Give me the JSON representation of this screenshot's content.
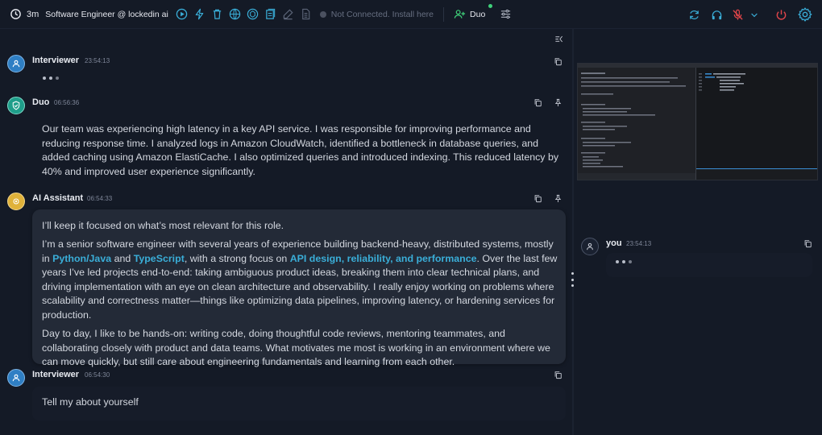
{
  "topbar": {
    "elapsed": "3m",
    "session_title": "Software Engineer @ lockedin ai",
    "connection_status": "Not Connected. Install here",
    "duo_label": "Duo"
  },
  "messages": [
    {
      "speaker": "Interviewer",
      "time": "23:54:13",
      "typing": true
    },
    {
      "speaker": "Duo",
      "time": "06:56:36",
      "text": "Our team was experiencing high latency in a key API service. I was responsible for improving performance and reducing response time. I analyzed logs in Amazon CloudWatch, identified a bottleneck in database queries, and added caching using Amazon ElastiCache. I also optimized queries and introduced indexing. This reduced latency by 40% and improved user experience significantly."
    },
    {
      "speaker": "AI Assistant",
      "time": "06:54:33",
      "intro": "I’ll keep it focused on what’s most relevant for this role.",
      "p2_a": "I’m a senior software engineer with several years of experience building backend-heavy, distributed systems, mostly in",
      "p2_hl1": "Python/Java",
      "p2_and": "and",
      "p2_hl2": "TypeScript",
      "p2_b": ", with a strong focus on",
      "p2_hl3": "API design, reliability, and performance",
      "p2_c": ". Over the last few years I’ve led projects end-to-end: taking ambiguous product ideas, breaking them into clear technical plans, and driving implementation with an eye on clean architecture and observability. I really enjoy working on problems where scalability and correctness matter—things like optimizing data pipelines, improving latency, or hardening services for production.",
      "p3": "Day to day, I like to be hands-on: writing code, doing thoughtful code reviews, mentoring teammates, and collaborating closely with product and data teams. What motivates me most is working in an environment where we can move quickly, but still care about engineering fundamentals and learning from each other."
    },
    {
      "speaker": "Interviewer",
      "time": "06:54:30",
      "text": "Tell my about yourself"
    }
  ],
  "side": {
    "speaker": "you",
    "time": "23:54:13",
    "typing": true
  },
  "colors": {
    "accent": "#3aaed8",
    "interviewer_avatar": "#2f7fc4",
    "duo_avatar": "#1f9e8a",
    "assistant_avatar": "#e0b23a",
    "power": "#e0454a"
  }
}
